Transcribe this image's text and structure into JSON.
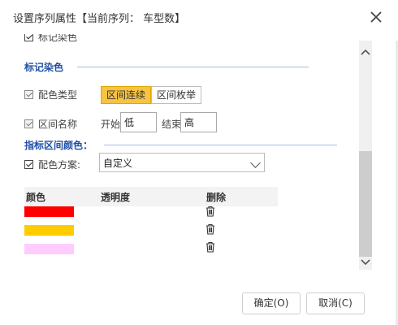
{
  "dialog": {
    "title": "设置序列属性【当前序列： 车型数】"
  },
  "partial_top": {
    "label": "标记染色"
  },
  "section_marker": {
    "title": "标记染色"
  },
  "color_type": {
    "label": "配色类型",
    "options": [
      "区间连续",
      "区间枚举"
    ],
    "selected": "区间连续"
  },
  "interval_name": {
    "label": "区间名称",
    "start_label": "开始",
    "start_value": "低",
    "end_label": "结束",
    "end_value": "高"
  },
  "section_indicator": {
    "title": "指标区间颜色："
  },
  "color_scheme": {
    "label": "配色方案:",
    "value": "自定义"
  },
  "table": {
    "headers": [
      "颜色",
      "透明度",
      "删除"
    ],
    "rows": [
      {
        "color": "#ff0000"
      },
      {
        "color": "#ffcc00"
      },
      {
        "color": "#ffccff"
      }
    ]
  },
  "buttons": {
    "ok": "确定(O)",
    "cancel": "取消(C)"
  },
  "colors": {
    "accent": "#f6c342",
    "section_title": "#1f4fa6"
  },
  "icons": [
    "close-icon",
    "checkbox-icon",
    "chevron-down-icon",
    "trash-icon",
    "scroll-up-icon",
    "scroll-down-icon"
  ]
}
